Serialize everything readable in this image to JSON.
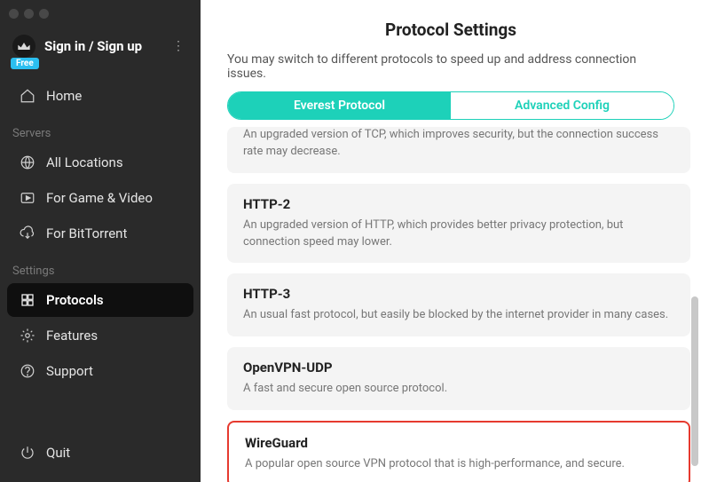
{
  "sidebar": {
    "signin": "Sign in / Sign up",
    "badge": "Free",
    "sections": {
      "servers_label": "Servers",
      "settings_label": "Settings"
    },
    "items": {
      "home": "Home",
      "all_locations": "All Locations",
      "game_video": "For Game & Video",
      "bittorrent": "For BitTorrent",
      "protocols": "Protocols",
      "features": "Features",
      "support": "Support",
      "quit": "Quit"
    }
  },
  "main": {
    "title": "Protocol Settings",
    "subtitle": "You may switch to different protocols to speed up and address connection issues.",
    "tabs": {
      "everest": "Everest Protocol",
      "advanced": "Advanced Config"
    },
    "protocols": [
      {
        "name": "",
        "desc": "An upgraded version of TCP, which improves security, but the connection success rate may decrease."
      },
      {
        "name": "HTTP-2",
        "desc": "An upgraded version of HTTP, which provides better privacy protection, but connection speed may lower."
      },
      {
        "name": "HTTP-3",
        "desc": "An usual fast protocol, but easily be blocked by the internet provider in many cases."
      },
      {
        "name": "OpenVPN-UDP",
        "desc": "A fast and secure open source protocol."
      },
      {
        "name": "WireGuard",
        "desc": "A popular open source VPN protocol that is high-performance, and secure."
      }
    ]
  },
  "colors": {
    "accent": "#1dd1b9",
    "highlight": "#e63a2f"
  }
}
